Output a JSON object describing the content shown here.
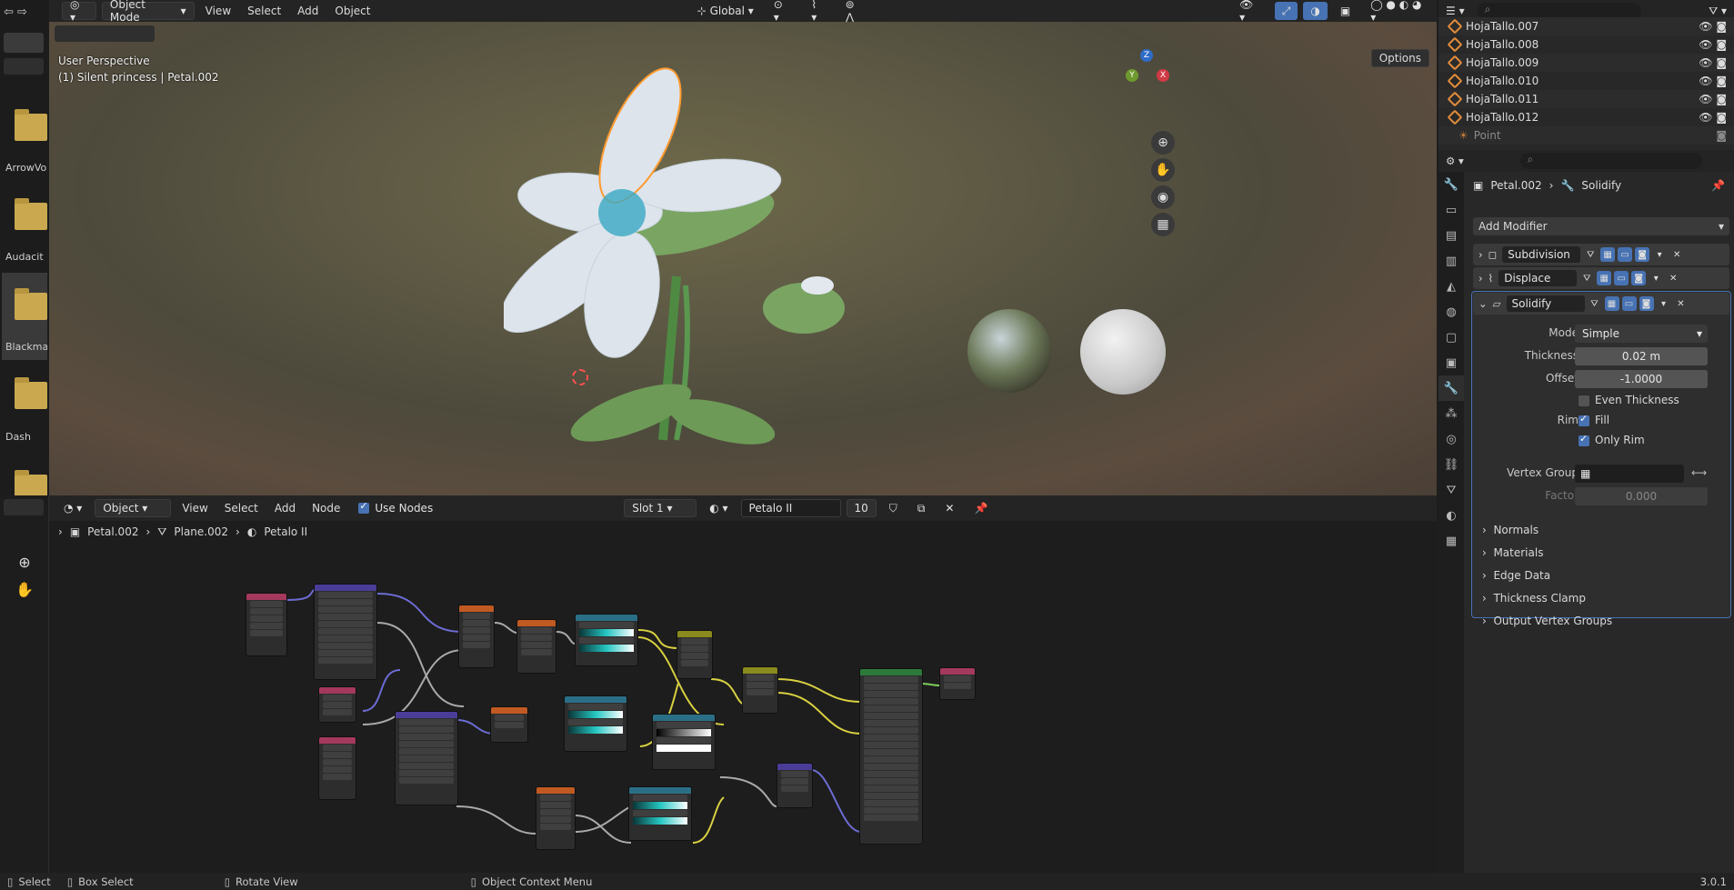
{
  "file_strip": {
    "items": [
      {
        "label": "ArrowVor"
      },
      {
        "label": "Audacit"
      },
      {
        "label": "Blackmag"
      },
      {
        "label": "Dash"
      }
    ]
  },
  "viewport": {
    "mode": "Object Mode",
    "menus": [
      "View",
      "Select",
      "Add",
      "Object"
    ],
    "transform_orientation": "Global",
    "perspective_label": "User Perspective",
    "object_label": "(1) Silent princess | Petal.002",
    "options_label": "Options",
    "axis_labels": {
      "z": "Z",
      "x": "X",
      "y": "Y"
    }
  },
  "node_editor": {
    "editor_type": "Object",
    "menus": [
      "View",
      "Select",
      "Add",
      "Node"
    ],
    "use_nodes_label": "Use Nodes",
    "use_nodes_checked": true,
    "slot": "Slot 1",
    "material_name": "Petalo II",
    "user_count": "10",
    "breadcrumb": [
      "Petal.002",
      "Plane.002",
      "Petalo II"
    ]
  },
  "outliner": {
    "rows": [
      {
        "label": "HojaTallo.007"
      },
      {
        "label": "HojaTallo.008"
      },
      {
        "label": "HojaTallo.009"
      },
      {
        "label": "HojaTallo.010"
      },
      {
        "label": "HojaTallo.011"
      },
      {
        "label": "HojaTallo.012"
      },
      {
        "label": "Point"
      }
    ]
  },
  "properties": {
    "breadcrumb_object": "Petal.002",
    "breadcrumb_modifier": "Solidify",
    "add_modifier_label": "Add Modifier",
    "modifiers": [
      {
        "name": "Subdivision",
        "expanded": false
      },
      {
        "name": "Displace",
        "expanded": false
      },
      {
        "name": "Solidify",
        "expanded": true
      }
    ],
    "solidify": {
      "mode_label": "Mode",
      "mode_value": "Simple",
      "thickness_label": "Thickness",
      "thickness_value": "0.02 m",
      "offset_label": "Offset",
      "offset_value": "-1.0000",
      "even_thickness_label": "Even Thickness",
      "even_thickness_checked": false,
      "rim_label": "Rim",
      "fill_label": "Fill",
      "fill_checked": true,
      "only_rim_label": "Only Rim",
      "only_rim_checked": true,
      "vertex_group_label": "Vertex Group",
      "factor_label": "Factor",
      "factor_value": "0.000"
    },
    "subpanels": [
      "Normals",
      "Materials",
      "Edge Data",
      "Thickness Clamp",
      "Output Vertex Groups"
    ]
  },
  "statusbar": {
    "items": [
      "Select",
      "Box Select",
      "Rotate View",
      "Object Context Menu"
    ],
    "version": "3.0.1"
  },
  "colors": {
    "accent": "#4772b3",
    "selection_outline": "#e38c3a",
    "panel_bg": "#282828"
  }
}
